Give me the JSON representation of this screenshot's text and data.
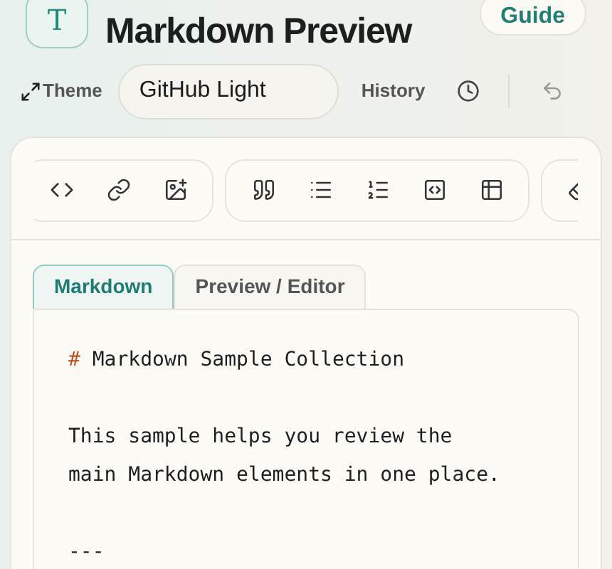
{
  "header": {
    "logo_letter": "T",
    "title": "Markdown Preview",
    "guide_button": "Guide"
  },
  "controls": {
    "theme_label": "Theme",
    "theme_value": "GitHub Light",
    "history_label": "History"
  },
  "tabs": [
    {
      "label": "Markdown",
      "selected": true
    },
    {
      "label": "Preview / Editor",
      "selected": false
    }
  ],
  "editor": {
    "lines": [
      {
        "kind": "heading",
        "marker": "#",
        "text": "Markdown Sample Collection"
      },
      {
        "kind": "blank"
      },
      {
        "kind": "text",
        "text": "This sample helps you review the"
      },
      {
        "kind": "text",
        "text": "main Markdown elements in one place."
      },
      {
        "kind": "blank"
      },
      {
        "kind": "text",
        "text": "---"
      }
    ]
  }
}
